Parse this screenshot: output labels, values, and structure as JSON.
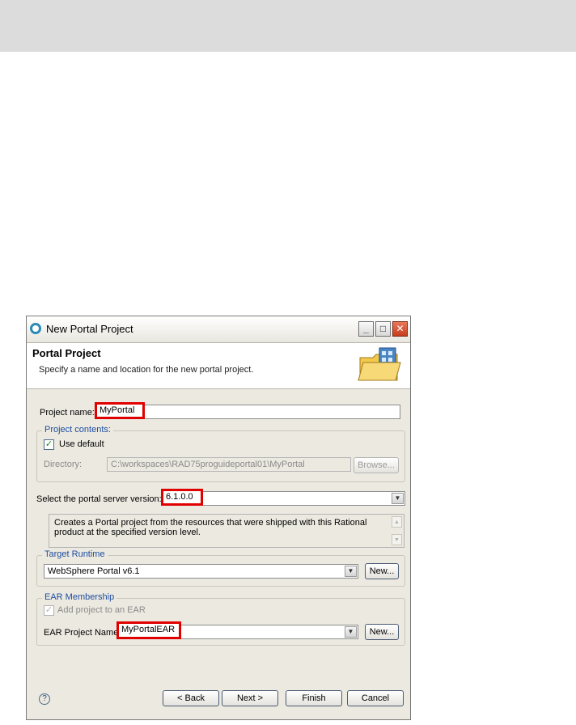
{
  "window": {
    "title": "New Portal Project"
  },
  "header": {
    "title": "Portal Project",
    "description": "Specify a name and location for the new portal project."
  },
  "project_name": {
    "label": "Project name:",
    "value": "MyPortal"
  },
  "project_contents": {
    "group_title": "Project contents:",
    "use_default_label": "Use default",
    "use_default_checked": true,
    "directory_label": "Directory:",
    "directory_value": "C:\\workspaces\\RAD75proguideportal01\\MyPortal",
    "browse_label": "Browse..."
  },
  "server_version": {
    "label": "Select the portal server version:",
    "value": "6.1.0.0",
    "description": "Creates a Portal project from the resources that were shipped with this Rational product at the specified version level."
  },
  "target_runtime": {
    "group_title": "Target Runtime",
    "value": "WebSphere Portal v6.1",
    "new_label": "New..."
  },
  "ear_membership": {
    "group_title": "EAR Membership",
    "add_to_ear_label": "Add project to an EAR",
    "add_to_ear_checked": true,
    "ear_name_label": "EAR Project Name:",
    "ear_name_value": "MyPortalEAR",
    "new_label": "New..."
  },
  "footer": {
    "back_label": "< Back",
    "next_label": "Next >",
    "finish_label": "Finish",
    "cancel_label": "Cancel"
  },
  "icons": {
    "help": "help-icon",
    "app": "eclipse-icon",
    "wizard": "portal-folder-icon"
  },
  "colors": {
    "highlight": "#e00000",
    "group_title": "#1e4da0"
  }
}
